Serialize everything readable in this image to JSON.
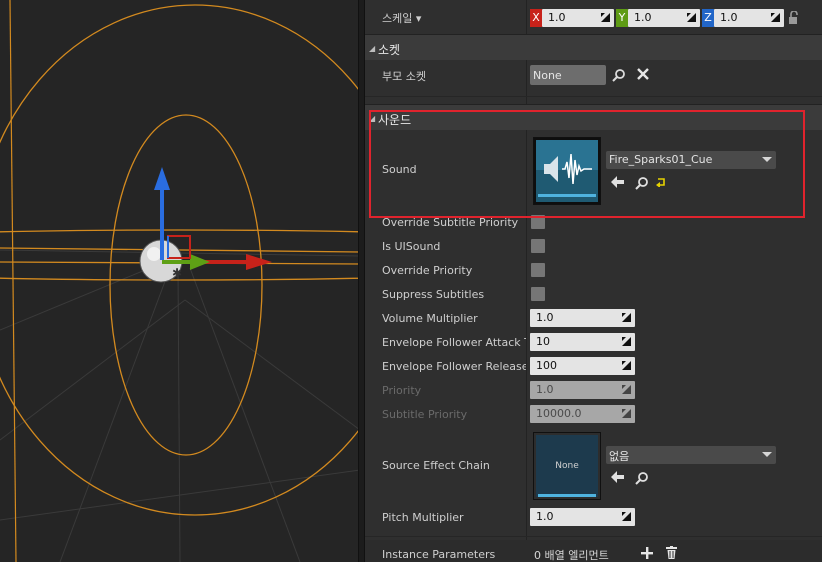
{
  "transform": {
    "scale_label": "스케일 ▾",
    "x_label": "X",
    "x_value": "1.0",
    "y_label": "Y",
    "y_value": "1.0",
    "z_label": "Z",
    "z_value": "1.0"
  },
  "socket": {
    "category": "소켓",
    "parent_socket_label": "부모 소켓",
    "parent_socket_value": "None"
  },
  "sound": {
    "category": "사운드",
    "sound_label": "Sound",
    "sound_asset": "Fire_Sparks01_Cue",
    "props": [
      {
        "label": "Override Subtitle Priority",
        "type": "checkbox",
        "enabled": true
      },
      {
        "label": "Is UISound",
        "type": "checkbox",
        "enabled": true
      },
      {
        "label": "Override Priority",
        "type": "checkbox",
        "enabled": true
      },
      {
        "label": "Suppress Subtitles",
        "type": "checkbox",
        "enabled": true
      },
      {
        "label": "Volume Multiplier",
        "type": "number",
        "value": "1.0",
        "enabled": true
      },
      {
        "label": "Envelope Follower Attack Tim",
        "type": "number",
        "value": "10",
        "enabled": true
      },
      {
        "label": "Envelope Follower Release T",
        "type": "number",
        "value": "100",
        "enabled": true
      },
      {
        "label": "Priority",
        "type": "number",
        "value": "1.0",
        "enabled": false
      },
      {
        "label": "Subtitle Priority",
        "type": "number",
        "value": "10000.0",
        "enabled": false
      }
    ],
    "source_effect_label": "Source Effect Chain",
    "source_effect_thumb": "None",
    "source_effect_value": "없음",
    "pitch_label": "Pitch Multiplier",
    "pitch_value": "1.0",
    "instance_label": "Instance Parameters",
    "instance_value": "0 배열 엘리먼트"
  },
  "colors": {
    "axis_x": "#c7221a",
    "axis_y": "#5e9b15",
    "axis_z": "#2266c8",
    "highlight": "#e0232d",
    "orbit": "#d38a1f"
  },
  "icons": [
    "search-icon",
    "clear-icon",
    "use-selected-icon",
    "browse-icon",
    "reset-icon",
    "lock-icon",
    "add-icon",
    "delete-icon",
    "speaker-icon"
  ]
}
